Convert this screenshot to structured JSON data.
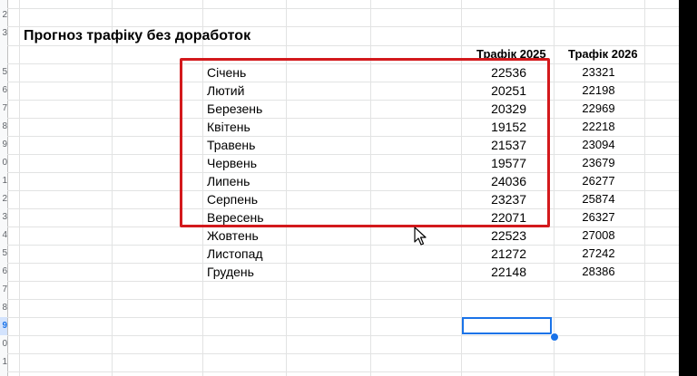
{
  "sheet": {
    "title": "Прогноз трафіку без доработок",
    "headers": {
      "traffic_2025": "Трафік 2025",
      "traffic_2026": "Трафік 2026"
    },
    "row_numbers": [
      "2",
      "3",
      "5",
      "6",
      "7",
      "8",
      "9",
      "0",
      "1",
      "2",
      "3",
      "4",
      "5",
      "6",
      "7",
      "8",
      "9",
      "0",
      "1"
    ],
    "rows": [
      {
        "month": "Січень",
        "t2025": "22536",
        "t2026": "23321"
      },
      {
        "month": "Лютий",
        "t2025": "20251",
        "t2026": "22198"
      },
      {
        "month": "Березень",
        "t2025": "20329",
        "t2026": "22969"
      },
      {
        "month": "Квітень",
        "t2025": "19152",
        "t2026": "22218"
      },
      {
        "month": "Травень",
        "t2025": "21537",
        "t2026": "23094"
      },
      {
        "month": "Червень",
        "t2025": "19577",
        "t2026": "23679"
      },
      {
        "month": "Липень",
        "t2025": "24036",
        "t2026": "26277"
      },
      {
        "month": "Серпень",
        "t2025": "23237",
        "t2026": "25874"
      },
      {
        "month": "Вересень",
        "t2025": "22071",
        "t2026": "26327"
      },
      {
        "month": "Жовтень",
        "t2025": "22523",
        "t2026": "27008"
      },
      {
        "month": "Листопад",
        "t2025": "21272",
        "t2026": "27242"
      },
      {
        "month": "Грудень",
        "t2025": "22148",
        "t2026": "28386"
      }
    ]
  },
  "colors": {
    "highlight": "#d3191c",
    "selection": "#1a73e8"
  },
  "icons": {
    "cursor": "mouse-pointer-icon"
  }
}
